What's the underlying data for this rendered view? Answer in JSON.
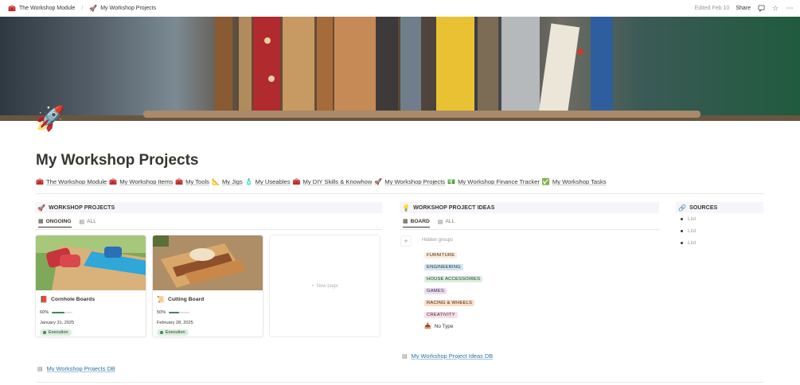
{
  "breadcrumb": {
    "items": [
      {
        "icon": "🧰",
        "label": "The Workshop Module"
      },
      {
        "icon": "🚀",
        "label": "My Workshop Projects"
      }
    ],
    "separator": "/"
  },
  "topbar": {
    "edited": "Edited Feb 10",
    "share": "Share"
  },
  "page": {
    "icon": "🚀",
    "title": "My Workshop Projects"
  },
  "links": [
    {
      "icon": "🧰",
      "label": "The Workshop Module"
    },
    {
      "icon": "🧰",
      "label": "My Workshop Items"
    },
    {
      "icon": "🧰",
      "label": "My Tools"
    },
    {
      "icon": "📐",
      "label": "My Jigs"
    },
    {
      "icon": "🧴",
      "label": "My Useables"
    },
    {
      "icon": "🧰",
      "label": "My DIY Skills & Knowhow"
    },
    {
      "icon": "🚀",
      "label": "My Workshop Projects"
    },
    {
      "icon": "💵",
      "label": "My Workshop Finance Tracker"
    },
    {
      "icon": "✅",
      "label": "My Workshop Tasks"
    }
  ],
  "projects": {
    "icon": "🚀",
    "heading": "WORKSHOP PROJECTS",
    "tabs": [
      {
        "icon": "▦",
        "label": "ONGOING"
      },
      {
        "icon": "▤",
        "label": "ALL"
      }
    ],
    "cards": [
      {
        "icon": "📕",
        "title": "Cornhole Boards",
        "progress_label": "60%",
        "progress": 0.6,
        "date": "January 31, 2025",
        "status": "Execution"
      },
      {
        "icon": "📜",
        "title": "Cutting Board",
        "progress_label": "50%",
        "progress": 0.5,
        "date": "February 28, 2025",
        "status": "Execution"
      }
    ],
    "new_page": "New page",
    "db_link": "My Workshop Projects DB"
  },
  "ideas": {
    "icon": "💡",
    "heading": "WORKSHOP PROJECT IDEAS",
    "tabs": [
      {
        "icon": "▦",
        "label": "BOARD"
      },
      {
        "icon": "▤",
        "label": "ALL"
      }
    ],
    "hidden_groups": "Hidden groups",
    "groups": [
      {
        "label": "FURNITURE",
        "bg": "#fbecdd",
        "fg": "#49290e"
      },
      {
        "label": "ENGINEERING",
        "bg": "#d3e5ef",
        "fg": "#183347"
      },
      {
        "label": "HOUSE ACCESSOIRES",
        "bg": "#dbeddb",
        "fg": "#1c3829"
      },
      {
        "label": "GAMES",
        "bg": "#e8deee",
        "fg": "#412454"
      },
      {
        "label": "RACING & WHEELS",
        "bg": "#fadec9",
        "fg": "#49290e"
      },
      {
        "label": "CREATIVITY",
        "bg": "#f5e0e9",
        "fg": "#4c2337"
      }
    ],
    "no_type": {
      "icon": "📥",
      "label": "No Type"
    },
    "db_link": "My Workshop Project Ideas DB"
  },
  "sources": {
    "icon": "🔗",
    "heading": "SOURCES",
    "items": [
      "List",
      "List",
      "List"
    ]
  }
}
